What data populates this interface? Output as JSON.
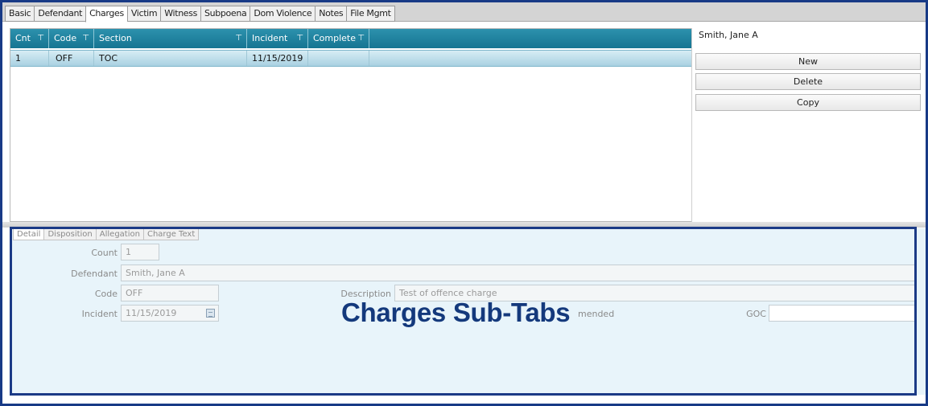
{
  "top_tabs": [
    "Basic",
    "Defendant",
    "Charges",
    "Victim",
    "Witness",
    "Subpoena",
    "Dom Violence",
    "Notes",
    "File Mgmt"
  ],
  "active_tab": "Charges",
  "grid": {
    "columns": [
      "Cnt",
      "Code",
      "Section",
      "Incident",
      "Complete"
    ],
    "rows": [
      {
        "cnt": "1",
        "code": "OFF",
        "section": "TOC",
        "incident": "11/15/2019",
        "complete": ""
      }
    ]
  },
  "side_panel": {
    "defendant_name": "Smith, Jane A",
    "buttons": {
      "new": "New",
      "delete": "Delete",
      "copy": "Copy"
    }
  },
  "sub_tabs": [
    "Detail",
    "Disposition",
    "Allegation",
    "Charge Text"
  ],
  "detail": {
    "count_label": "Count",
    "count_value": "1",
    "defendant_label": "Defendant",
    "defendant_value": "Smith, Jane A",
    "code_label": "Code",
    "code_value": "OFF",
    "description_label": "Description",
    "description_value": "Test of offence charge",
    "incident_label": "Incident",
    "incident_value": "11/15/2019",
    "amended_label": "mended",
    "goc_label": "GOC",
    "goc_value": ""
  },
  "annotation": {
    "text": "Charges Sub-Tabs"
  },
  "colors": {
    "header": "#1d7f9c",
    "selected_row": "#b9dcea",
    "annotation": "#14397c",
    "panel": "#e8f4fa"
  },
  "icons": [
    "filter-icon",
    "calendar-icon"
  ]
}
